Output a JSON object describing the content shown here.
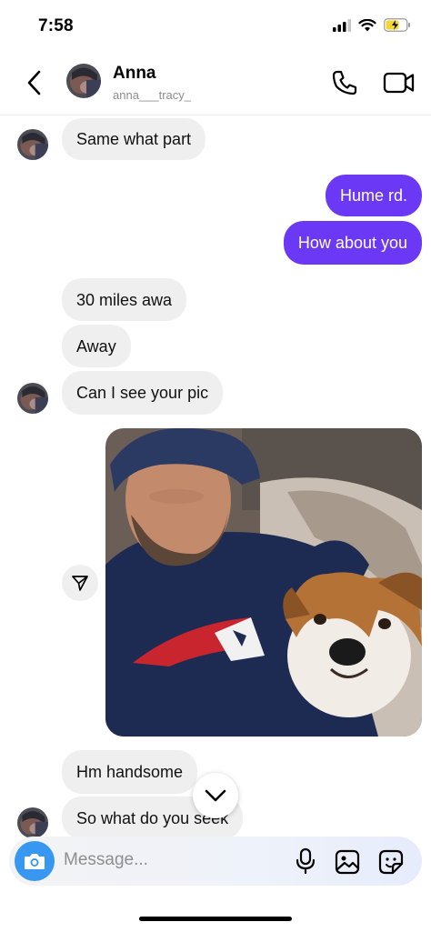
{
  "status_bar": {
    "time": "7:58"
  },
  "header": {
    "name": "Anna",
    "username": "anna___tracy_"
  },
  "messages": [
    {
      "text": "Same what part"
    },
    {
      "text": "Hume rd."
    },
    {
      "text": "How about you"
    },
    {
      "text": "30 miles awa"
    },
    {
      "text": "Away"
    },
    {
      "text": "Can I see your pic"
    },
    {
      "text": "Hm handsome"
    },
    {
      "text": "So what do you seek"
    }
  ],
  "composer": {
    "placeholder": "Message..."
  },
  "colors": {
    "outgoing": "#6b38f5",
    "incoming": "#efefef",
    "camera": "#3897f0"
  },
  "icons": [
    "back-icon",
    "phone-icon",
    "video-icon",
    "send-icon",
    "chevron-down-icon",
    "camera-icon",
    "mic-icon",
    "gallery-icon",
    "sticker-icon"
  ]
}
